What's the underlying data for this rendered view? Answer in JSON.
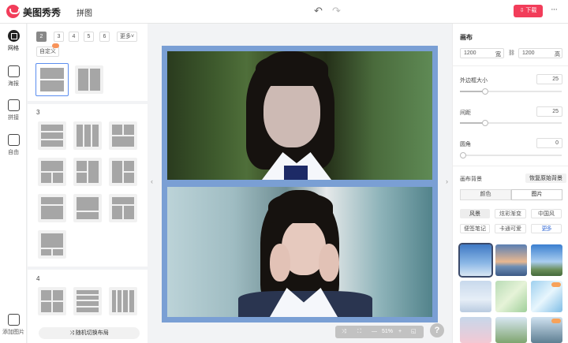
{
  "app": {
    "name": "美图秀秀",
    "page_title": "拼图",
    "download_label": "下载",
    "more_label": "···"
  },
  "nav": {
    "items": [
      {
        "label": "网格",
        "icon": "grid-icon",
        "active": true
      },
      {
        "label": "海报",
        "icon": "poster-icon",
        "active": false
      },
      {
        "label": "拼接",
        "icon": "stitch-icon",
        "active": false
      },
      {
        "label": "自由",
        "icon": "free-layout-icon",
        "active": false
      }
    ],
    "add_image_label": "添加图片"
  },
  "layouts": {
    "counts": [
      "2",
      "3",
      "4",
      "5",
      "6"
    ],
    "active_count": "2",
    "more_label": "更多",
    "custom_label": "自定义",
    "section_3": "3",
    "section_4": "4",
    "shuffle_label": "随机切换布局"
  },
  "canvas": {
    "zoom": "51%",
    "zoom_minus": "—",
    "zoom_plus": "+"
  },
  "right": {
    "canvas_title": "画布",
    "width_value": "1200",
    "width_unit": "宽",
    "height_value": "1200",
    "height_unit": "高",
    "border_label": "外边框大小",
    "border_value": "25",
    "spacing_label": "间距",
    "spacing_value": "25",
    "corner_label": "圆角",
    "corner_value": "0",
    "bg_label": "画布背景",
    "reset_bg_label": "恢复原始背景",
    "tab_color": "颜色",
    "tab_image": "图片",
    "categories": [
      "风景",
      "炫彩渐变",
      "中国风",
      "便签笔记",
      "卡通可爱",
      "更多"
    ],
    "active_category": "风景"
  },
  "colors": {
    "accent": "#f23d5a",
    "frame": "#7a9fd4",
    "link": "#3b6fd6"
  }
}
